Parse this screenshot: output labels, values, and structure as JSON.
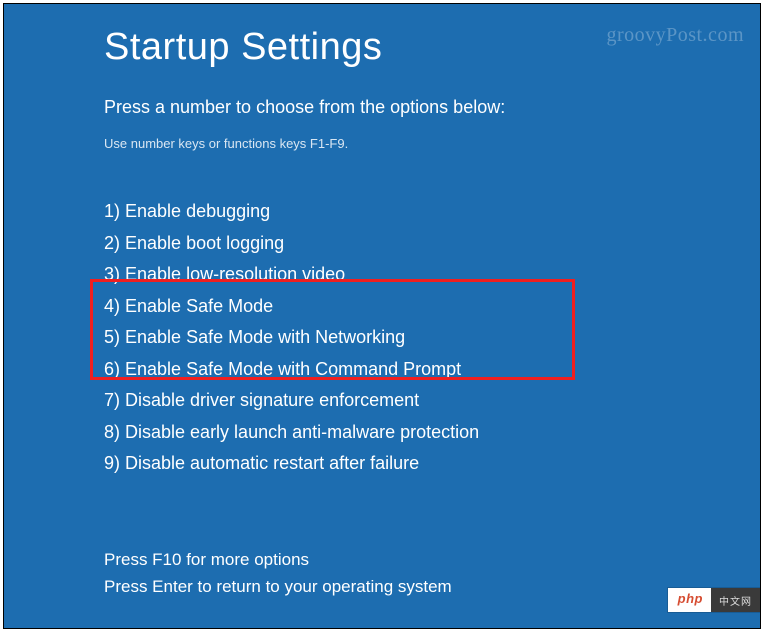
{
  "title": "Startup Settings",
  "subtitle": "Press a number to choose from the options below:",
  "hint": "Use number keys or functions keys F1-F9.",
  "options": [
    {
      "num": "1",
      "label": "Enable debugging"
    },
    {
      "num": "2",
      "label": "Enable boot logging"
    },
    {
      "num": "3",
      "label": "Enable low-resolution video"
    },
    {
      "num": "4",
      "label": "Enable Safe Mode"
    },
    {
      "num": "5",
      "label": "Enable Safe Mode with Networking"
    },
    {
      "num": "6",
      "label": "Enable Safe Mode with Command Prompt"
    },
    {
      "num": "7",
      "label": "Disable driver signature enforcement"
    },
    {
      "num": "8",
      "label": "Disable early launch anti-malware protection"
    },
    {
      "num": "9",
      "label": "Disable automatic restart after failure"
    }
  ],
  "footer": {
    "more": "Press F10 for more options",
    "return": "Press Enter to return to your operating system"
  },
  "watermark": "groovyPost.com",
  "badge": {
    "left": "php",
    "right": "中文网"
  }
}
